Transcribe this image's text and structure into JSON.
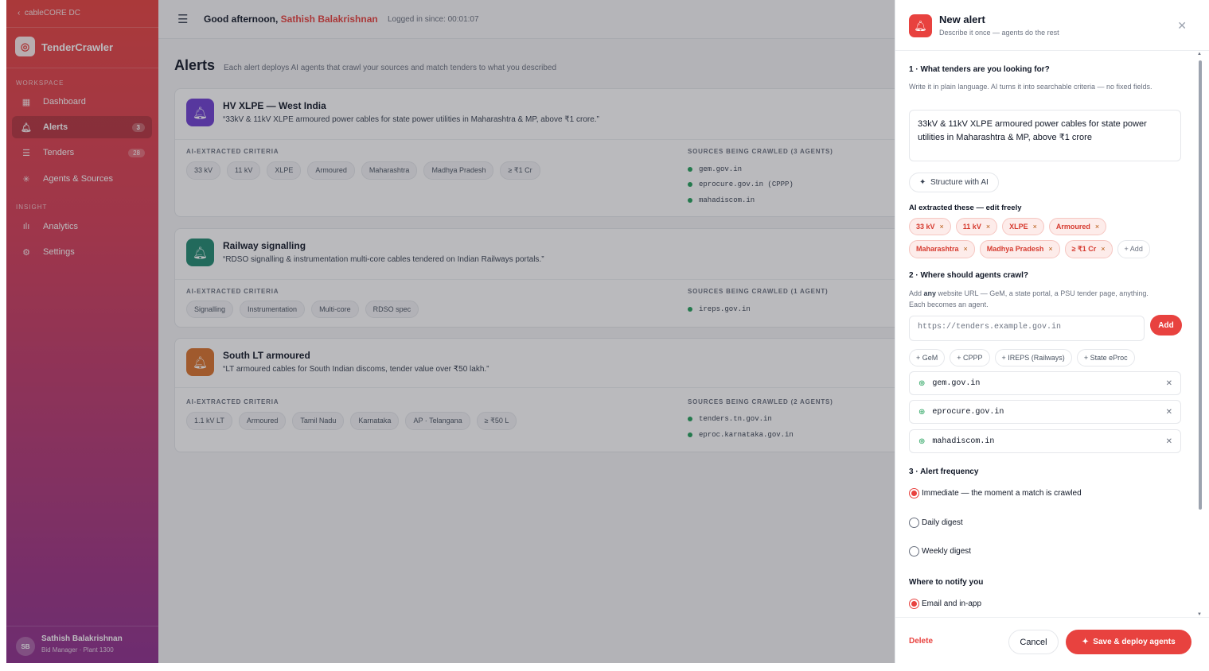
{
  "sidebar": {
    "back_label": "cableCORE DC",
    "brand": "TenderCrawler",
    "section_workspace": "WORKSPACE",
    "section_insight": "INSIGHT",
    "items": [
      {
        "label": "Dashboard",
        "badge": ""
      },
      {
        "label": "Alerts",
        "badge": "3"
      },
      {
        "label": "Tenders",
        "badge": "28"
      },
      {
        "label": "Agents & Sources",
        "badge": ""
      },
      {
        "label": "Analytics",
        "badge": ""
      },
      {
        "label": "Settings",
        "badge": ""
      }
    ],
    "user": {
      "initials": "SB",
      "name": "Sathish Balakrishnan",
      "role": "Bid Manager · Plant 1300"
    }
  },
  "topbar": {
    "greeting": "Good afternoon, ",
    "user_name": "Sathish Balakrishnan",
    "logged_in": "Logged in since: 00:01:07"
  },
  "page": {
    "title": "Alerts",
    "subtitle": "Each alert deploys AI agents that crawl your sources and match tenders to what you described"
  },
  "labels": {
    "criteria": "AI-EXTRACTED CRITERIA"
  },
  "alerts": [
    {
      "title": "HV XLPE — West India",
      "description": "“33kV & 11kV XLPE armoured power cables for state power utilities in Maharashtra & MP, above ₹1 crore.”",
      "criteria": [
        "33 kV",
        "11 kV",
        "XLPE",
        "Armoured",
        "Maharashtra",
        "Madhya Pradesh",
        "≥ ₹1 Cr"
      ],
      "sources_label": "SOURCES BEING CRAWLED (3 AGENTS)",
      "sources": [
        "gem.gov.in",
        "eprocure.gov.in (CPPP)",
        "mahadiscom.in"
      ],
      "color": "#6d3fd1"
    },
    {
      "title": "Railway signalling",
      "description": "“RDSO signalling & instrumentation multi-core cables tendered on Indian Railways portals.”",
      "criteria": [
        "Signalling",
        "Instrumentation",
        "Multi-core",
        "RDSO spec"
      ],
      "sources_label": "SOURCES BEING CRAWLED (1 AGENT)",
      "sources": [
        "ireps.gov.in"
      ],
      "color": "#1f8a70"
    },
    {
      "title": "South LT armoured",
      "description": "“LT armoured cables for South Indian discoms, tender value over ₹50 lakh.”",
      "criteria": [
        "1.1 kV LT",
        "Armoured",
        "Tamil Nadu",
        "Karnataka",
        "AP · Telangana",
        "≥ ₹50 L"
      ],
      "sources_label": "SOURCES BEING CRAWLED (2 AGENTS)",
      "sources": [
        "tenders.tn.gov.in",
        "eproc.karnataka.gov.in"
      ],
      "color": "#d9722b"
    }
  ],
  "panel": {
    "title": "New alert",
    "subtitle": "Describe it once — agents do the rest",
    "q1": "1 · What tenders are you looking for?",
    "q1_help": "Write it in plain language. AI turns it into searchable criteria — no fixed fields.",
    "q1_value": "33kV & 11kV XLPE armoured power cables for state power utilities in Maharashtra & MP, above ₹1 crore",
    "structure_btn": "Structure with AI",
    "extracted_label": "AI extracted these — edit freely",
    "tags": [
      "33 kV",
      "11 kV",
      "XLPE",
      "Armoured",
      "Maharashtra",
      "Madhya Pradesh",
      "≥ ₹1 Cr"
    ],
    "add_tag": "+ Add",
    "q2": "2 · Where should agents crawl?",
    "q2_help_pre": "Add ",
    "q2_help_bold": "any",
    "q2_help_post": " website URL — GeM, a state portal, a PSU tender page, anything. Each becomes an agent.",
    "url_placeholder": "https://tenders.example.gov.in",
    "add_btn": "Add",
    "quick_adds": [
      "+ GeM",
      "+ CPPP",
      "+ IREPS (Railways)",
      "+ State eProc"
    ],
    "sources": [
      "gem.gov.in",
      "eprocure.gov.in",
      "mahadiscom.in"
    ],
    "q3": "3 · Alert frequency",
    "freq_options": [
      "Immediate — the moment a match is crawled",
      "Daily digest",
      "Weekly digest"
    ],
    "freq_selected": 0,
    "notify_label": "Where to notify you",
    "notify_option": "Email and in-app",
    "delete": "Delete",
    "cancel": "Cancel",
    "save": "Save & deploy agents"
  }
}
